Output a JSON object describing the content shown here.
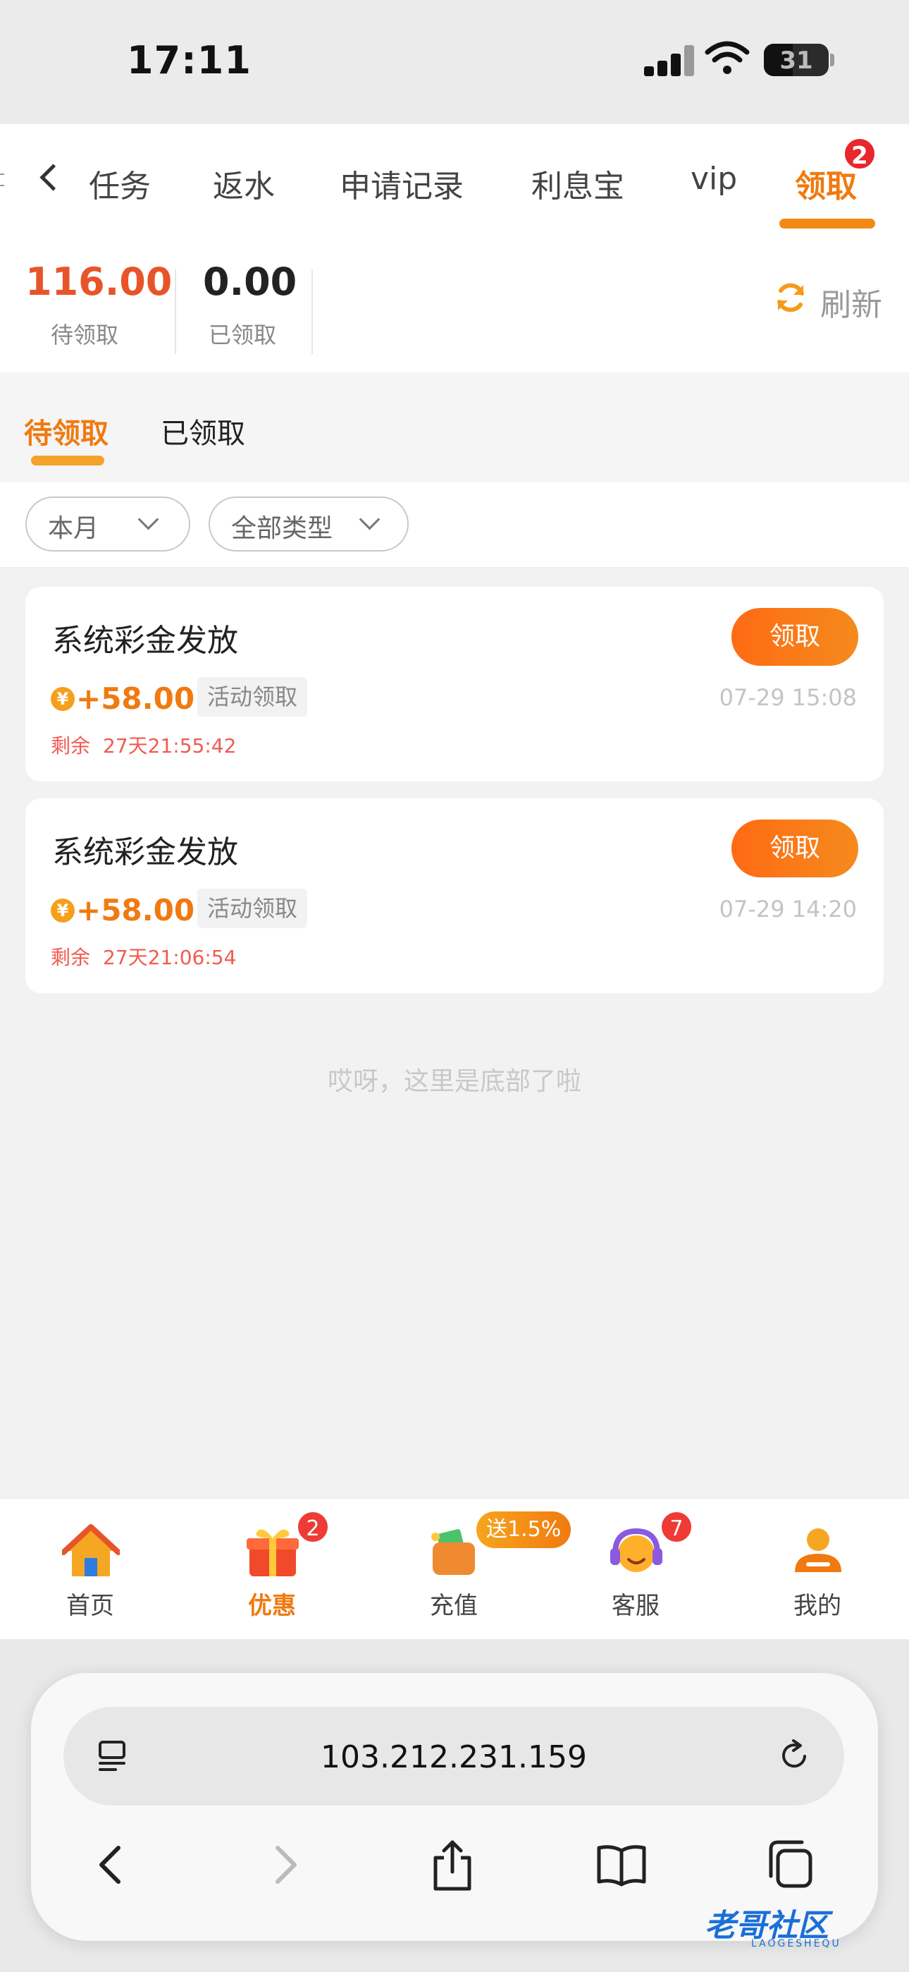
{
  "status_bar": {
    "time": "17:11",
    "battery": "31"
  },
  "top_tabs": {
    "items": [
      "任务",
      "返水",
      "申请记录",
      "利息宝",
      "vip",
      "领取"
    ],
    "active": "领取",
    "badge": "2"
  },
  "summary": {
    "pending_value": "116.00",
    "pending_label": "待领取",
    "claimed_value": "0.00",
    "claimed_label": "已领取",
    "refresh_label": "刷新"
  },
  "sub_tabs": {
    "pending": "待领取",
    "claimed": "已领取"
  },
  "filters": {
    "month": "本月",
    "type": "全部类型"
  },
  "records": [
    {
      "title": "系统彩金发放",
      "button": "领取",
      "coin": "¥",
      "amount": "+58.00",
      "tag": "活动领取",
      "time": "07-29 15:08",
      "remain_label": "剩余",
      "remain_value": "27天21:55:42"
    },
    {
      "title": "系统彩金发放",
      "button": "领取",
      "coin": "¥",
      "amount": "+58.00",
      "tag": "活动领取",
      "time": "07-29 14:20",
      "remain_label": "剩余",
      "remain_value": "27天21:06:54"
    }
  ],
  "bottom_note": "哎呀，这里是底部了啦",
  "bottom_nav": {
    "home": "首页",
    "offers": "优惠",
    "offers_badge": "2",
    "recharge": "充值",
    "recharge_promo": "送1.5%",
    "service": "客服",
    "service_badge": "7",
    "mine": "我的"
  },
  "browser": {
    "url": "103.212.231.159"
  },
  "watermark": {
    "title": "老哥社区",
    "sub": "LAOGESHEQU"
  },
  "colors": {
    "accent": "#f07a10",
    "badge": "#e8262b",
    "remain": "#f15b50"
  }
}
